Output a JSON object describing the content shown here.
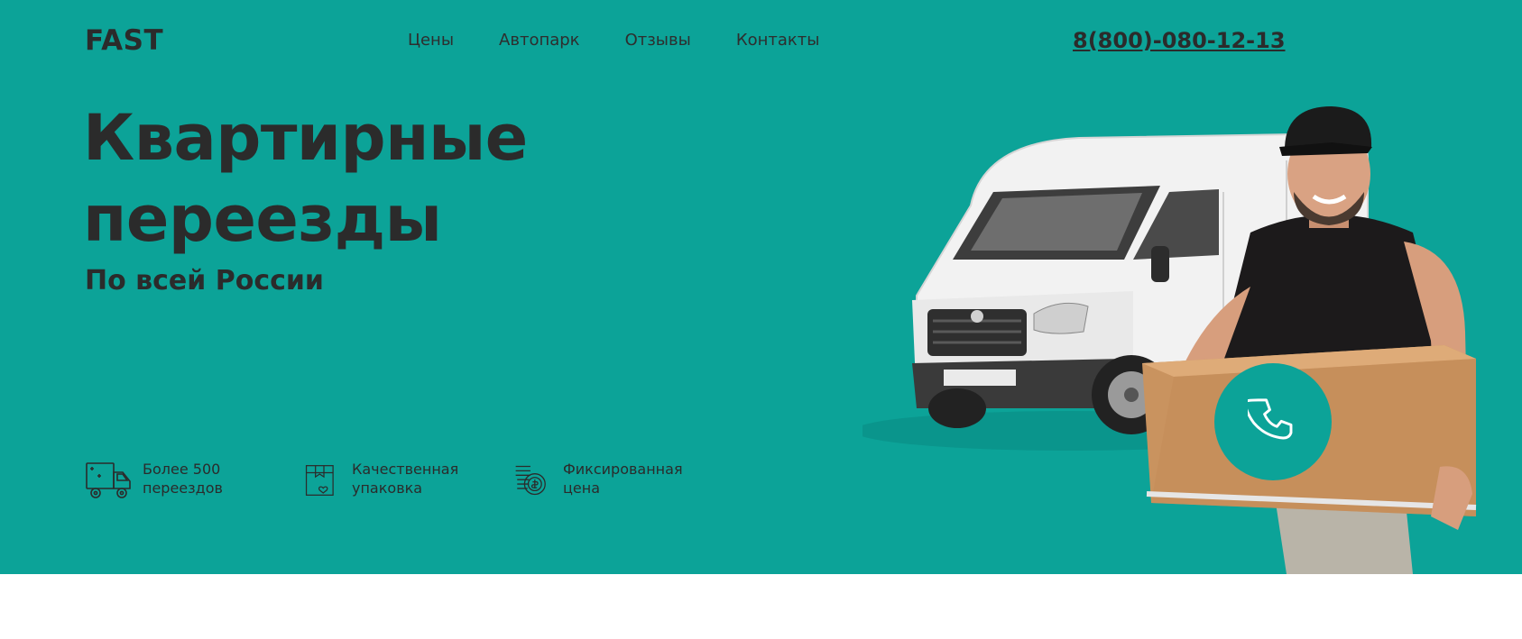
{
  "header": {
    "logo": "FAST",
    "nav": [
      "Цены",
      "Автопарк",
      "Отзывы",
      "Контакты"
    ],
    "phone": "8(800)-080-12-13"
  },
  "hero": {
    "title_line1": "Квартирные",
    "title_line2": "переезды",
    "subtitle": "По всей России"
  },
  "features": [
    {
      "icon": "truck-icon",
      "line1": "Более 500",
      "line2": "переездов"
    },
    {
      "icon": "package-icon",
      "line1": "Качественная",
      "line2": "упаковка"
    },
    {
      "icon": "coins-icon",
      "line1": "Фиксированная",
      "line2": "цена"
    }
  ],
  "call_button": {
    "icon": "phone-icon"
  },
  "colors": {
    "accent": "#0ca398",
    "text": "#2b2b2b",
    "background": "#ffffff"
  }
}
